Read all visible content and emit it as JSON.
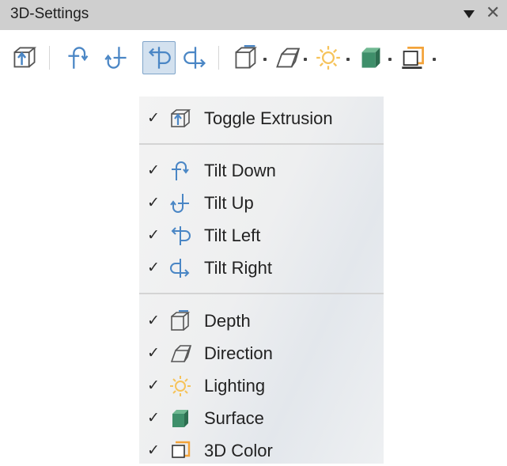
{
  "panel": {
    "title": "3D-Settings",
    "close_glyph": "✕",
    "collapse_icon": "triangle-down-icon"
  },
  "colors": {
    "title_bar": "#cfcfcf",
    "icon_blue": "#4a86c5",
    "surface_green": "#3e8f6a",
    "color_orange": "#f3a33a",
    "lighting_yellow": "#f6c35a",
    "active_button": "#d3e1ef"
  },
  "toolbar": {
    "buttons": [
      {
        "icon": "toggle-extrusion-icon",
        "active": false
      },
      {
        "icon": "tilt-down-icon",
        "active": false
      },
      {
        "icon": "tilt-up-icon",
        "active": false
      },
      {
        "icon": "tilt-left-icon",
        "active": true
      },
      {
        "icon": "tilt-right-icon",
        "active": false
      },
      {
        "icon": "depth-icon",
        "active": false,
        "dropdown": true
      },
      {
        "icon": "direction-icon",
        "active": false,
        "dropdown": true
      },
      {
        "icon": "lighting-icon",
        "active": false,
        "dropdown": true
      },
      {
        "icon": "surface-icon",
        "active": false,
        "dropdown": true
      },
      {
        "icon": "3d-color-icon",
        "active": false,
        "dropdown": true
      }
    ]
  },
  "menu": {
    "check_glyph": "✓",
    "groups": [
      [
        {
          "label": "Toggle Extrusion",
          "icon": "toggle-extrusion-icon",
          "checked": true
        }
      ],
      [
        {
          "label": "Tilt Down",
          "icon": "tilt-down-icon",
          "checked": true
        },
        {
          "label": "Tilt Up",
          "icon": "tilt-up-icon",
          "checked": true
        },
        {
          "label": "Tilt Left",
          "icon": "tilt-left-icon",
          "checked": true
        },
        {
          "label": "Tilt Right",
          "icon": "tilt-right-icon",
          "checked": true
        }
      ],
      [
        {
          "label": "Depth",
          "icon": "depth-icon",
          "checked": true
        },
        {
          "label": "Direction",
          "icon": "direction-icon",
          "checked": true
        },
        {
          "label": "Lighting",
          "icon": "lighting-icon",
          "checked": true
        },
        {
          "label": "Surface",
          "icon": "surface-icon",
          "checked": true
        },
        {
          "label": "3D Color",
          "icon": "3d-color-icon",
          "checked": true
        }
      ]
    ]
  }
}
